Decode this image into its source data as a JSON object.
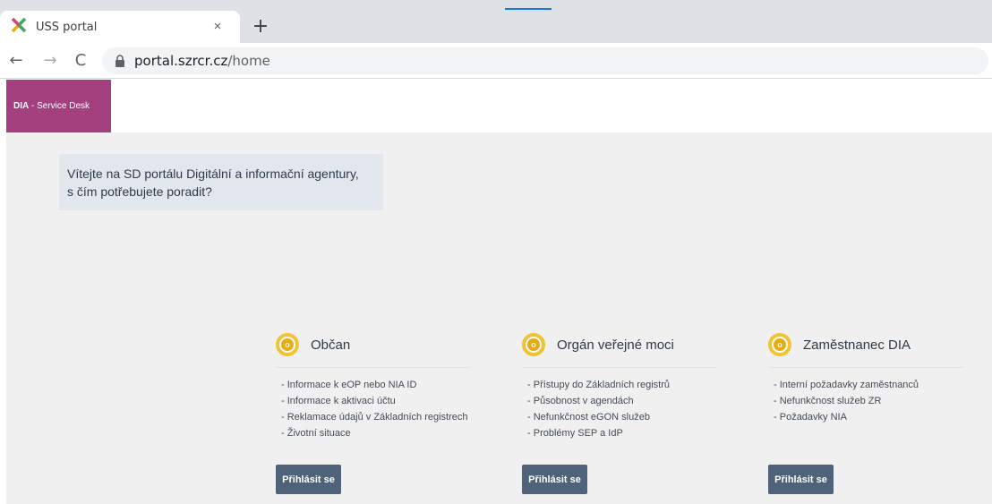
{
  "browser": {
    "tab_title": "USS portal",
    "tab_close": "×",
    "new_tab": "+",
    "back": "←",
    "forward": "→",
    "reload": "C",
    "url_host": "portal.szrcr.cz",
    "url_path": "/home"
  },
  "header": {
    "brand_bold": "DIA",
    "brand_rest": " - Service Desk",
    "brand_color": "#a5407f"
  },
  "welcome": {
    "line1": "Vítejte na SD portálu Digitální a informační agentury,",
    "line2": "s čím potřebujete poradit?"
  },
  "cards": [
    {
      "title": "Občan",
      "items": [
        "Informace k eOP nebo NIA ID",
        "Informace k aktivaci účtu",
        "Reklamace údajů v Základních registrech",
        "Životní situace"
      ],
      "button": "Přihlásit se"
    },
    {
      "title": "Orgán veřejné moci",
      "items": [
        "Přístupy do Základních registrů",
        "Působnost v agendách",
        "Nefunkčnost eGON služeb",
        "Problémy SEP a IdP"
      ],
      "button": "Přihlásit se"
    },
    {
      "title": "Zaměstnanec DIA",
      "items": [
        "Interní požadavky zaměstnanců",
        "Nefunkčnost služeb ZR",
        "Požadavky NIA"
      ],
      "button": "Přihlásit se"
    }
  ],
  "icon_letter": "o",
  "colors": {
    "accent": "#f2c230",
    "button": "#4e637a",
    "welcome_bg": "#e2e7ee"
  }
}
